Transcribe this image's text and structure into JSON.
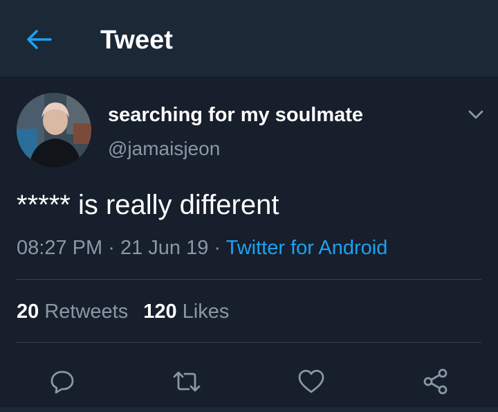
{
  "header": {
    "title": "Tweet",
    "back_icon": "arrow-left-icon"
  },
  "tweet": {
    "display_name": "searching for my soulmate",
    "handle": "@jamaisjeon",
    "text": "***** is really different",
    "time": "08:27 PM",
    "date": "21 Jun 19",
    "separator": "·",
    "source": "Twitter for Android",
    "retweets_count": "20",
    "retweets_label": "Retweets",
    "likes_count": "120",
    "likes_label": "Likes"
  },
  "actions": {
    "reply_icon": "reply-icon",
    "retweet_icon": "retweet-icon",
    "like_icon": "heart-icon",
    "share_icon": "share-icon"
  },
  "colors": {
    "background": "#161f2b",
    "header_background": "#1b2836",
    "accent": "#1da1f2",
    "secondary_text": "#8899a6",
    "divider": "#38444d"
  }
}
